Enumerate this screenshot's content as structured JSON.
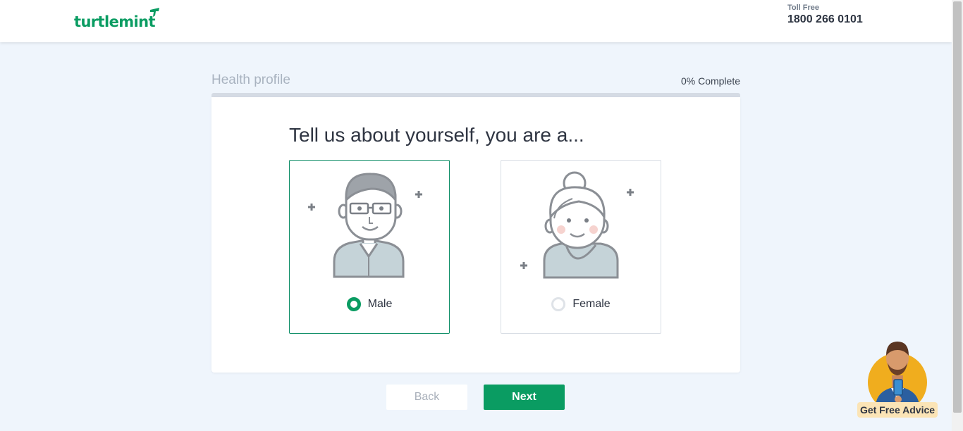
{
  "header": {
    "logo_text": "turtlemint",
    "toll_free_label": "Toll Free",
    "toll_free_number": "1800 266 0101"
  },
  "progress": {
    "title": "Health profile",
    "complete_text": "0% Complete",
    "fraction": 0
  },
  "question": "Tell us about yourself, you are a...",
  "options": [
    {
      "label": "Male",
      "selected": true
    },
    {
      "label": "Female",
      "selected": false
    }
  ],
  "buttons": {
    "back": "Back",
    "next": "Next"
  },
  "advice_widget": {
    "label": "Get Free Advice"
  },
  "colors": {
    "brand": "#0a9c62",
    "background": "#eff5fc"
  }
}
